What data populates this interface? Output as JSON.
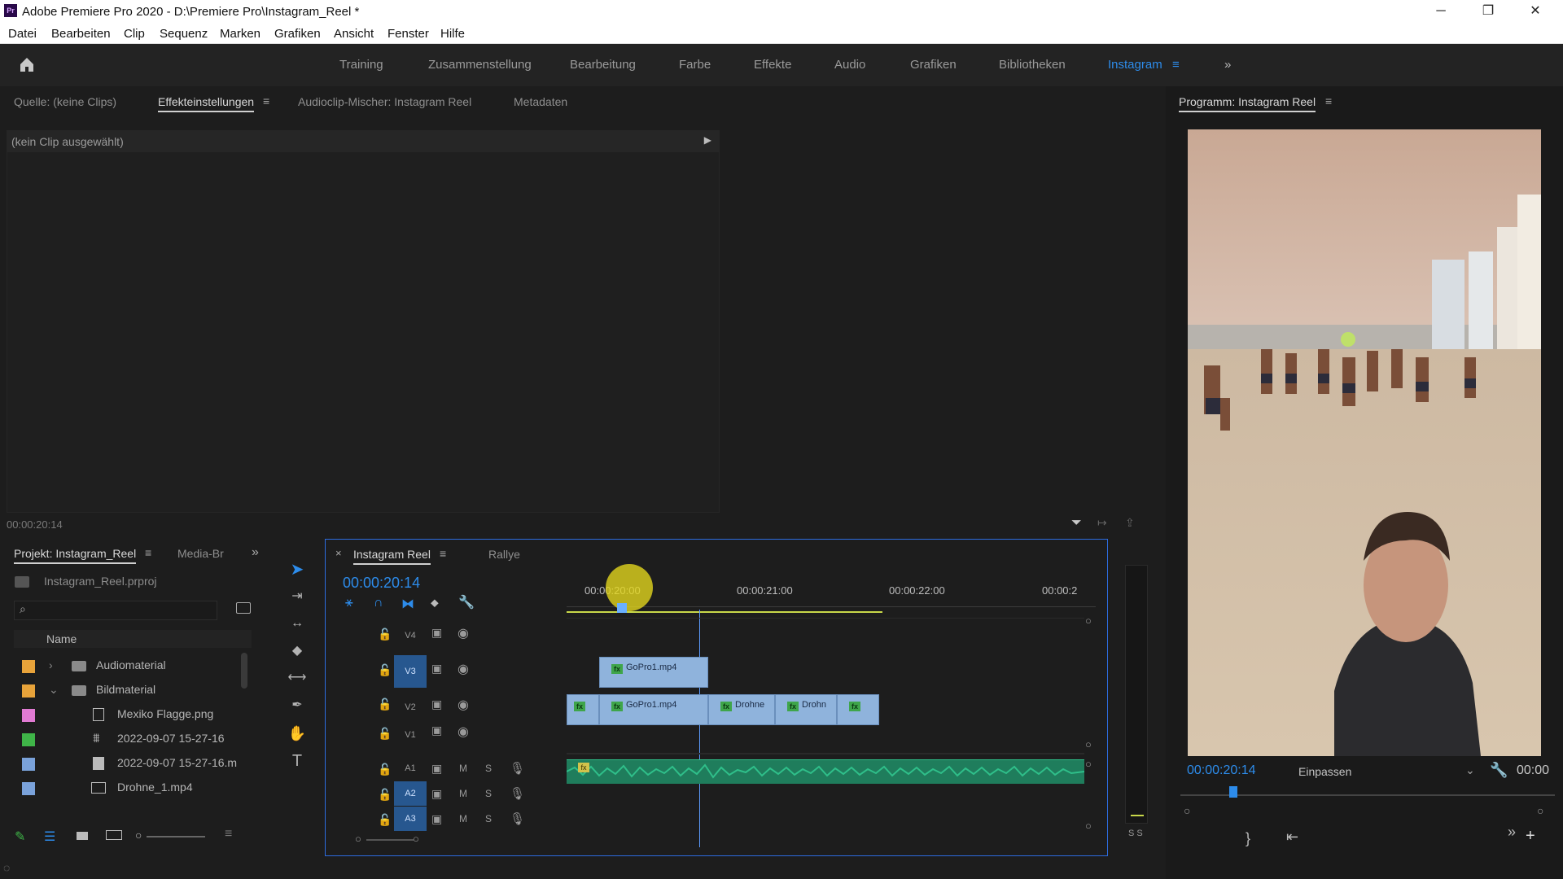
{
  "window": {
    "app_icon_text": "Pr",
    "title": "Adobe Premiere Pro 2020 - D:\\Premiere Pro\\Instagram_Reel *",
    "minimize": "─",
    "restore": "❐",
    "close": "✕"
  },
  "menu": [
    "Datei",
    "Bearbeiten",
    "Clip",
    "Sequenz",
    "Marken",
    "Grafiken",
    "Ansicht",
    "Fenster",
    "Hilfe"
  ],
  "workspaces": {
    "items": [
      "Training",
      "Zusammenstellung",
      "Bearbeitung",
      "Farbe",
      "Effekte",
      "Audio",
      "Grafiken",
      "Bibliotheken",
      "Instagram"
    ],
    "active": "Instagram",
    "active_color": "#2d8ceb",
    "overflow": "»"
  },
  "source_panel": {
    "tabs": [
      "Quelle: (keine Clips)",
      "Effekteinstellungen",
      "Audioclip-Mischer: Instagram Reel",
      "Metadaten"
    ],
    "active_tab": "Effekteinstellungen",
    "no_clip": "(kein Clip ausgewählt)",
    "timecode": "00:00:20:14"
  },
  "program_panel": {
    "title": "Programm: Instagram Reel",
    "timecode": "00:00:20:14",
    "fit": "Einpassen",
    "timecode_right": "00:00"
  },
  "project_panel": {
    "tabs": [
      "Projekt: Instagram_Reel",
      "Media-Br"
    ],
    "file": "Instagram_Reel.prproj",
    "column_name": "Name",
    "items": [
      {
        "name": "Audiomaterial",
        "type": "folder",
        "color": "#e8a33a",
        "expand": "›"
      },
      {
        "name": "Bildmaterial",
        "type": "folder",
        "color": "#e8a33a",
        "expand": "⌄"
      },
      {
        "name": "Mexiko Flagge.png",
        "type": "image",
        "color": "#e07ad2"
      },
      {
        "name": "2022-09-07 15-27-16",
        "type": "sequence",
        "color": "#3fb548"
      },
      {
        "name": "2022-09-07 15-27-16.m",
        "type": "file",
        "color": "#7aa2da"
      },
      {
        "name": "Drohne_1.mp4",
        "type": "video",
        "color": "#7aa2da"
      }
    ]
  },
  "timeline": {
    "tabs": [
      "Instagram Reel",
      "Rallye"
    ],
    "close": "×",
    "timecode": "00:00:20:14",
    "ruler": [
      "00:00:20:00",
      "00:00:21:00",
      "00:00:22:00",
      "00:00:2"
    ],
    "tracks": {
      "video": [
        "V4",
        "V3",
        "V2",
        "V1"
      ],
      "audio": [
        "A1",
        "A2",
        "A3"
      ],
      "mute": "M",
      "solo": "S"
    },
    "clips": {
      "v3": [
        "GoPro1.mp4"
      ],
      "v2": [
        "",
        "GoPro1.mp4",
        "Drohne",
        "Drohn",
        ""
      ]
    },
    "clip_fx": "fx",
    "meter_labels": "S S",
    "clip_color": "#8fb3dc",
    "audio_color": "#2fbf8a"
  },
  "icons": {
    "home": "home-icon",
    "tools": [
      "selection-tool-icon",
      "track-select-icon",
      "ripple-edit-icon",
      "razor-icon",
      "slip-icon",
      "pen-icon",
      "hand-icon",
      "type-icon"
    ]
  }
}
